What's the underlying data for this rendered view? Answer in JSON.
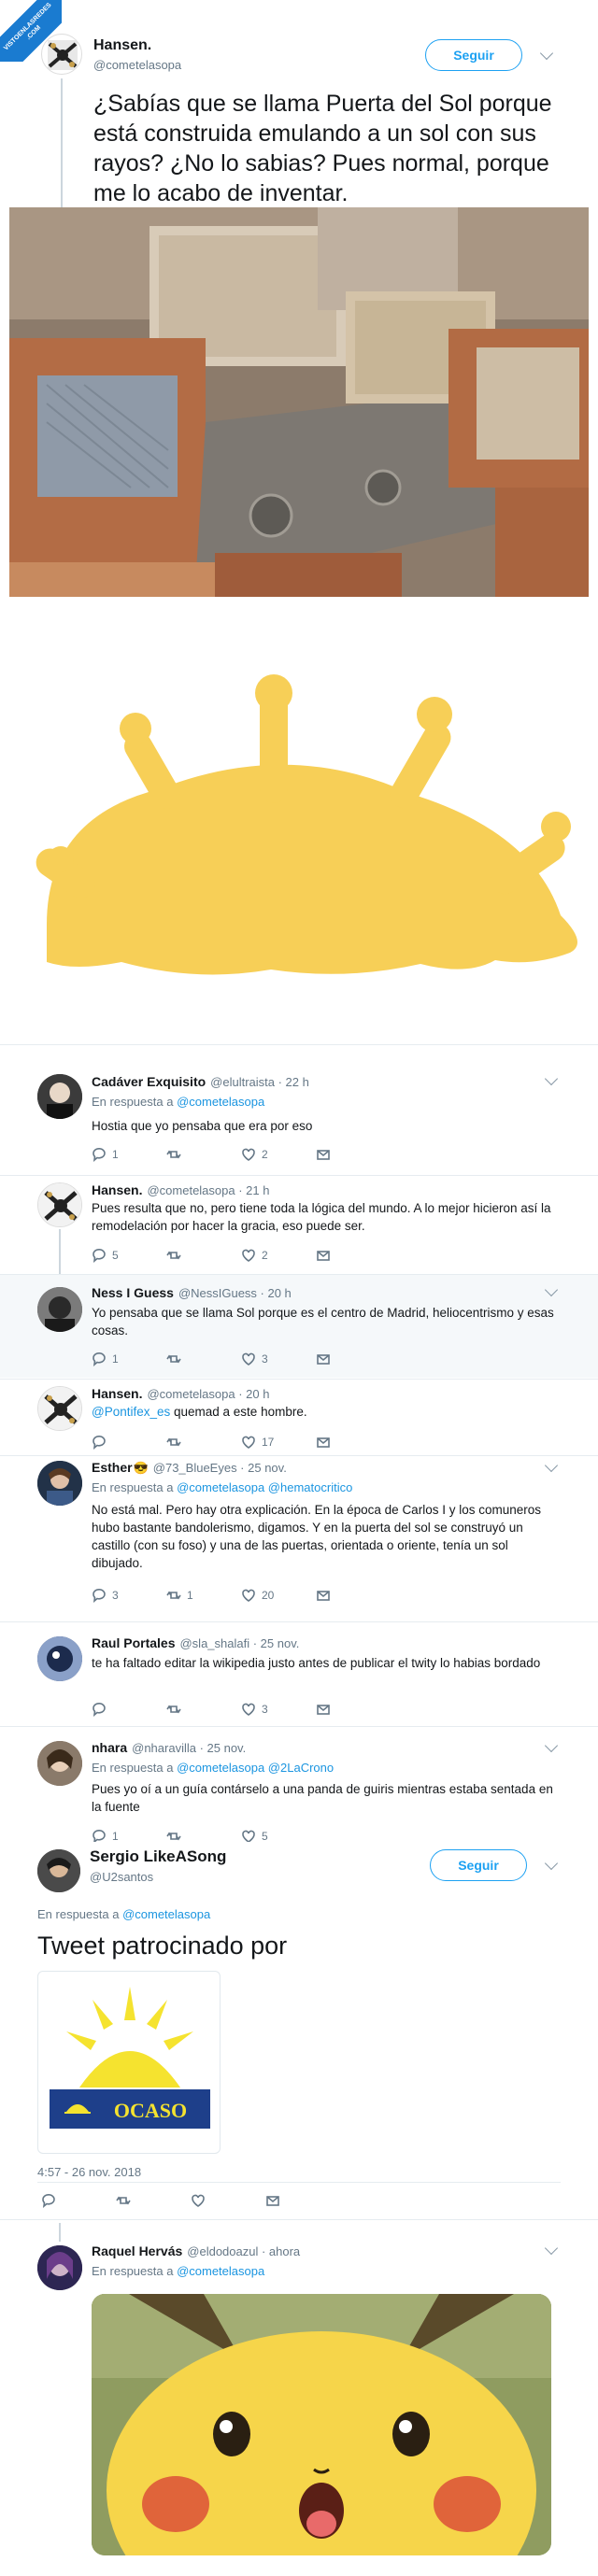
{
  "watermark": {
    "line1": "VISTOENLASREDES",
    "line2": ".COM"
  },
  "main": {
    "name": "Hansen.",
    "handle": "@cometelasopa",
    "follow": "Seguir",
    "text": "¿Sabías que se llama Puerta del Sol porque está construida emulando a un sol con sus rayos? ¿No lo sabias? Pues normal, porque me lo acabo de inventar.",
    "colors": {
      "sun": "#f7cf57",
      "accent": "#1da1f2"
    }
  },
  "replies": [
    {
      "name": "Cadáver Exquisito",
      "handle": "@elultraista · 22 h",
      "in_reply": "En respuesta a ",
      "in_reply_to": "@cometelasopa",
      "text": "Hostia que yo pensaba que era por eso",
      "counts": {
        "reply": "1",
        "retweet": "",
        "like": "2"
      }
    },
    {
      "name": "Hansen.",
      "handle": "@cometelasopa · 21 h",
      "text": "Pues resulta que no, pero tiene toda la lógica del mundo. A lo mejor hicieron así la remodelación por hacer la gracia, eso puede ser.",
      "counts": {
        "reply": "5",
        "retweet": "",
        "like": "2"
      }
    },
    {
      "name": "Ness I Guess",
      "handle": "@NessIGuess · 20 h",
      "text": "Yo pensaba que se llama Sol porque   es el centro de Madrid, heliocentrismo y esas cosas.",
      "counts": {
        "reply": "1",
        "retweet": "",
        "like": "3"
      }
    },
    {
      "name": "Hansen.",
      "handle": "@cometelasopa · 20 h",
      "mention": "@Pontifex_es",
      "text": " quemad a este hombre.",
      "counts": {
        "reply": "",
        "retweet": "",
        "like": "17"
      }
    },
    {
      "name": "Esther",
      "emoji": "😎",
      "handle": "@73_BlueEyes · 25 nov.",
      "in_reply": "En respuesta a ",
      "in_reply_to": "@cometelasopa @hematocritico",
      "text": "No está mal. Pero hay otra explicación. En la época de Carlos I y los comuneros hubo bastante bandolerismo, digamos. Y en la puerta del sol se construyó un castillo (con su foso) y una de las puertas, orientada o oriente, tenía un sol dibujado.",
      "counts": {
        "reply": "3",
        "retweet": "1",
        "like": "20"
      }
    },
    {
      "name": "Raul Portales",
      "handle": "@sla_shalafi · 25 nov.",
      "text": "te ha faltado editar la wikipedia justo antes de publicar el twity lo habias bordado",
      "counts": {
        "reply": "",
        "retweet": "",
        "like": "3"
      }
    },
    {
      "name": "nhara",
      "handle": "@nharavilla · 25 nov.",
      "in_reply": "En respuesta a ",
      "in_reply_to": "@cometelasopa @2LaCrono",
      "text": "Pues yo oí a un guía contárselo a una panda de guiris mientras estaba sentada en la fuente",
      "counts": {
        "reply": "1",
        "retweet": "",
        "like": "5"
      }
    }
  ],
  "sponsor": {
    "name": "Sergio LikeASong",
    "handle": "@U2santos",
    "follow": "Seguir",
    "in_reply": "En respuesta a ",
    "in_reply_to": "@cometelasopa",
    "text": "Tweet patrocinado por",
    "logo_text": "OCASO",
    "time": "4:57 - 26 nov. 2018"
  },
  "last": {
    "name": "Raquel Hervás",
    "handle": "@eldodoazul · ahora",
    "in_reply": "En respuesta a ",
    "in_reply_to": "@cometelasopa"
  }
}
